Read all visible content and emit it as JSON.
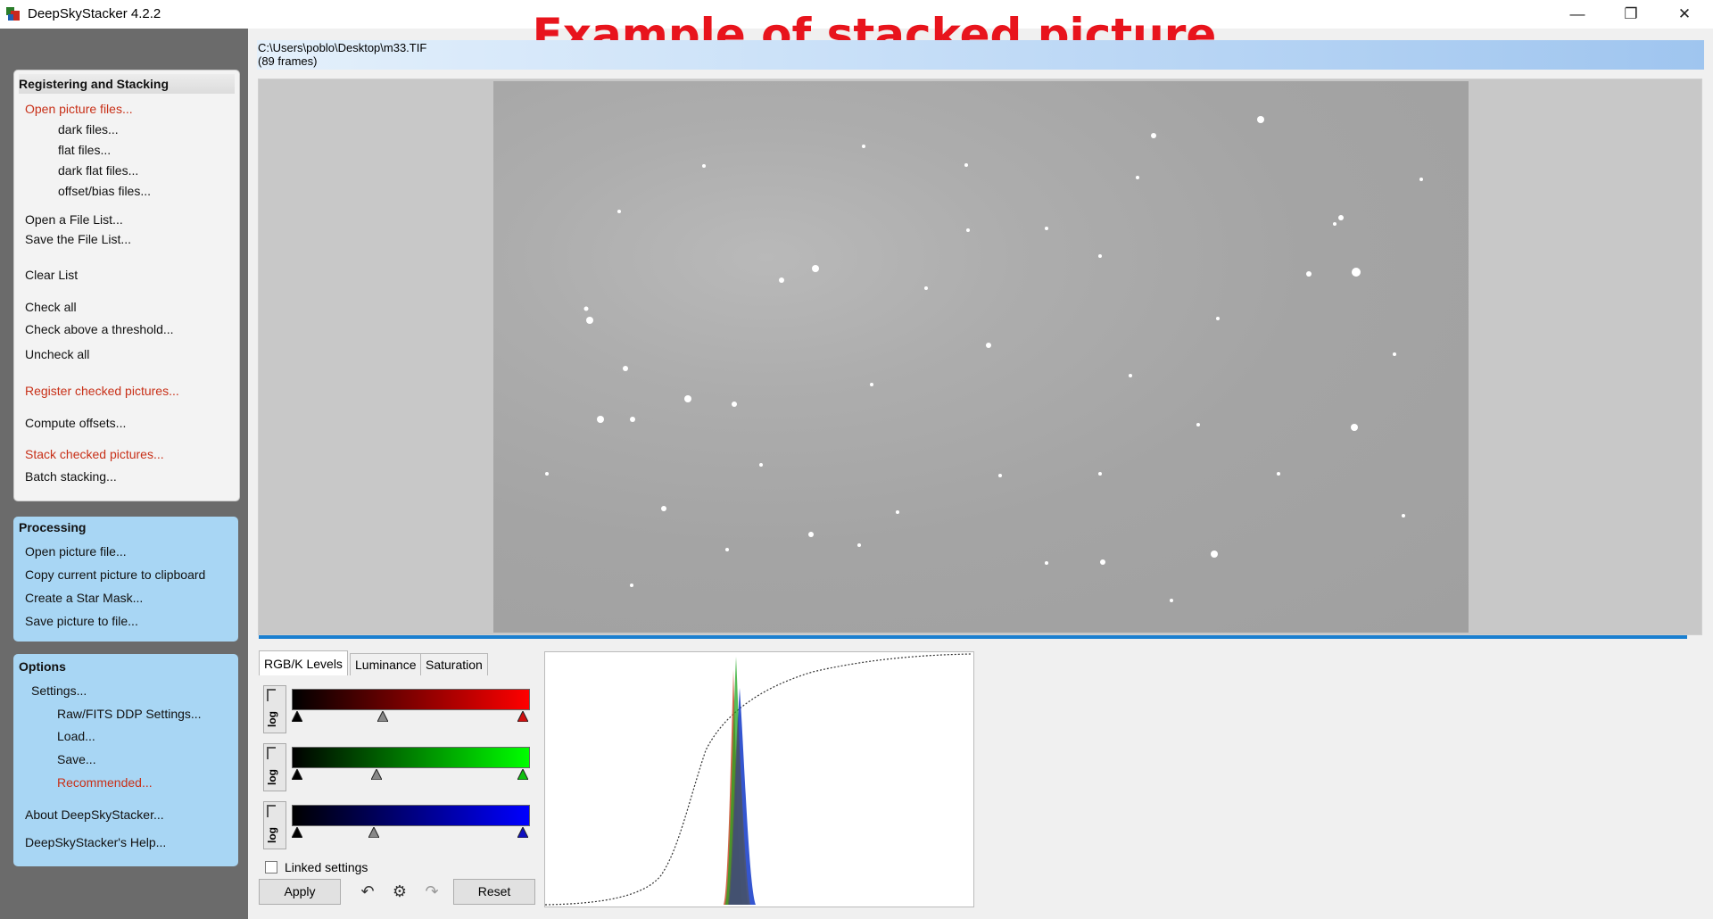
{
  "window": {
    "title": "DeepSkyStacker 4.2.2"
  },
  "overlay": {
    "caption": "Example of stacked picture"
  },
  "registering": {
    "header": "Registering and Stacking",
    "open_picture_files": "Open picture files...",
    "dark_files": "dark files...",
    "flat_files": "flat files...",
    "dark_flat_files": "dark flat files...",
    "offset_bias_files": "offset/bias files...",
    "open_file_list": "Open a File List...",
    "save_file_list": "Save the File List...",
    "clear_list": "Clear List",
    "check_all": "Check all",
    "check_above_threshold": "Check above a threshold...",
    "uncheck_all": "Uncheck all",
    "register_checked": "Register checked pictures...",
    "compute_offsets": "Compute offsets...",
    "stack_checked": "Stack checked pictures...",
    "batch_stacking": "Batch stacking..."
  },
  "processing": {
    "header": "Processing",
    "open_picture_file": "Open picture file...",
    "copy_to_clipboard": "Copy current picture to clipboard",
    "create_star_mask": "Create a Star Mask...",
    "save_picture": "Save picture to file..."
  },
  "options": {
    "header": "Options",
    "settings": "Settings...",
    "raw_fits": "Raw/FITS DDP Settings...",
    "load": "Load...",
    "save": "Save...",
    "recommended": "Recommended...",
    "about": "About DeepSkyStacker...",
    "help": "DeepSkyStacker's Help..."
  },
  "file": {
    "path": "C:\\Users\\poblo\\Desktop\\m33.TIF",
    "frames": "(89 frames)"
  },
  "tabs": {
    "rgb": "RGB/K Levels",
    "luminance": "Luminance",
    "saturation": "Saturation"
  },
  "levels": {
    "log_label": "log",
    "red": {
      "black": 0.0,
      "mid": 0.38,
      "white": 1.0
    },
    "green": {
      "black": 0.0,
      "mid": 0.35,
      "white": 1.0
    },
    "blue": {
      "black": 0.0,
      "mid": 0.34,
      "white": 1.0
    },
    "linked_label": "Linked settings",
    "linked_checked": false
  },
  "buttons": {
    "apply": "Apply",
    "reset": "Reset"
  },
  "icons": [
    "undo-icon",
    "settings-wheel-icon",
    "redo-icon"
  ],
  "colors": {
    "accent_blue": "#1a7fd0",
    "menu_red": "#c83018",
    "panel_blue": "#a8d6f4",
    "overlay_red": "#e8141c"
  }
}
